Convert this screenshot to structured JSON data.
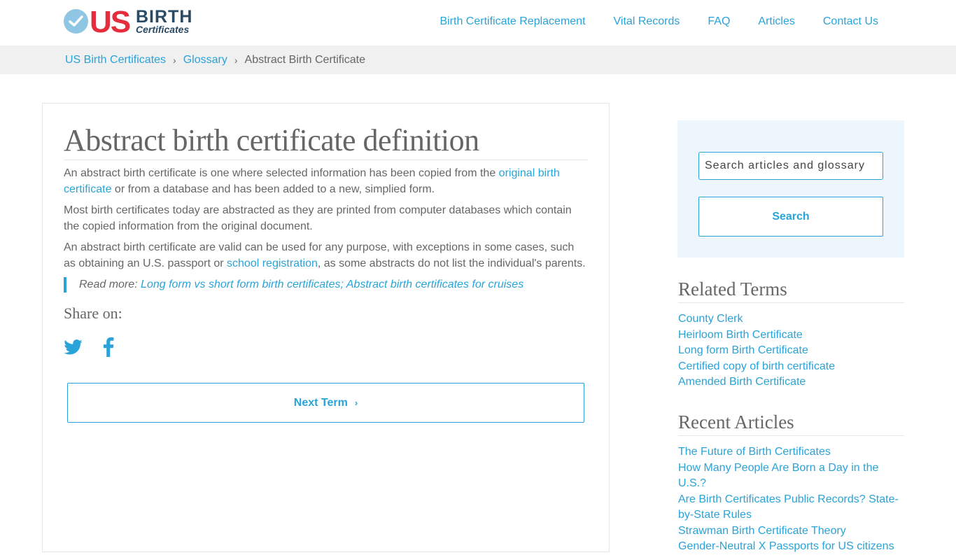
{
  "header": {
    "logo": {
      "us": "US",
      "birth": "BIRTH",
      "certificates": "Certificates"
    },
    "nav": [
      "Birth Certificate Replacement",
      "Vital Records",
      "FAQ",
      "Articles",
      "Contact Us"
    ]
  },
  "breadcrumb": {
    "home": "US Birth Certificates",
    "section": "Glossary",
    "current": "Abstract Birth Certificate",
    "separator": "›"
  },
  "main": {
    "title": "Abstract birth certificate definition",
    "p1": {
      "before": "An abstract birth certificate is one where selected information has been copied from the ",
      "link": "original birth certificate",
      "after": " or from a database and has been added to a new, simplied form."
    },
    "p2": "Most birth certificates today are abstracted as they are printed from computer databases which contain the copied information from the original document.",
    "p3": {
      "before": "An abstract birth certificate are valid can be used for any purpose, with exceptions in some cases, such as obtaining an U.S. passport or ",
      "link": "school registration",
      "after": ", as some abstracts do not list the individual's parents."
    },
    "read_more": {
      "label": "Read more: ",
      "link1": "Long form vs short form birth certificates",
      "sep": "; ",
      "link2": "Abstract birth certificates for cruises"
    },
    "share_label": "Share on:",
    "next_label": "Next Term",
    "next_chevron": "›"
  },
  "sidebar": {
    "search_placeholder": "Search articles and glossary",
    "search_button": "Search",
    "related_title": "Related Terms",
    "related": [
      "County Clerk",
      "Heirloom Birth Certificate",
      "Long form Birth Certificate",
      "Certified copy of birth certificate",
      "Amended Birth Certificate"
    ],
    "recent_title": "Recent Articles",
    "recent": [
      "The Future of Birth Certificates",
      "How Many People Are Born a Day in the U.S.?",
      "Are Birth Certificates Public Records? State-by-State Rules",
      "Strawman Birth Certificate Theory",
      "Gender-Neutral X Passports for US citizens"
    ]
  },
  "colors": {
    "accent": "#29a3d8",
    "logo_red": "#e52e3d",
    "logo_navy": "#2b4a63",
    "breadcrumb_bg": "#f0f0f0",
    "search_panel_bg": "#eef6fd"
  },
  "icons": {
    "logo": "check-circle-icon",
    "share1": "twitter-icon",
    "share2": "facebook-icon"
  }
}
